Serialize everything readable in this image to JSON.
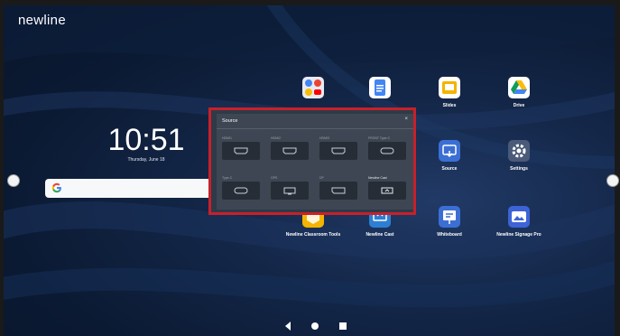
{
  "brand": "newline",
  "clock": {
    "time": "10:51",
    "date": "Thursday, June 18"
  },
  "search": {
    "placeholder": ""
  },
  "apps": [
    {
      "label": "",
      "icon": "google-apps-folder-icon"
    },
    {
      "label": "",
      "icon": "docs-icon"
    },
    {
      "label": "Slides",
      "icon": "slides-icon",
      "color": "#f4b400"
    },
    {
      "label": "Drive",
      "icon": "drive-icon"
    },
    {
      "label": "Source",
      "icon": "source-icon",
      "color": "#3b6fd4"
    },
    {
      "label": "Settings",
      "icon": "settings-icon",
      "color": "#4a5a78"
    },
    {
      "label": "Newline Classroom Tools",
      "icon": "classroom-tools-icon",
      "color": "#f4b400"
    },
    {
      "label": "Newline Cast",
      "icon": "cast-icon",
      "color": "#2d7fd3"
    },
    {
      "label": "Whiteboard",
      "icon": "whiteboard-icon",
      "color": "#3b6fd4"
    },
    {
      "label": "Newline Signage Pro",
      "icon": "signage-icon",
      "color": "#3d63d6"
    }
  ],
  "source_dialog": {
    "title": "Source",
    "close": "×",
    "sources": [
      {
        "name": "HDMI1",
        "icon": "hdmi-port-icon"
      },
      {
        "name": "HDMI2",
        "icon": "hdmi-port-icon"
      },
      {
        "name": "HDMI3",
        "icon": "hdmi-port-icon"
      },
      {
        "name": "FRONT Type-C",
        "icon": "usb-c-port-icon"
      },
      {
        "name": "Type-C",
        "icon": "usb-c-port-icon"
      },
      {
        "name": "OPS",
        "icon": "ops-icon"
      },
      {
        "name": "DP",
        "icon": "displayport-icon"
      },
      {
        "name": "Newline Cast",
        "icon": "cast-screen-icon"
      }
    ]
  },
  "navigation": [
    "back",
    "home",
    "recents"
  ],
  "highlight_color": "#c8202a"
}
